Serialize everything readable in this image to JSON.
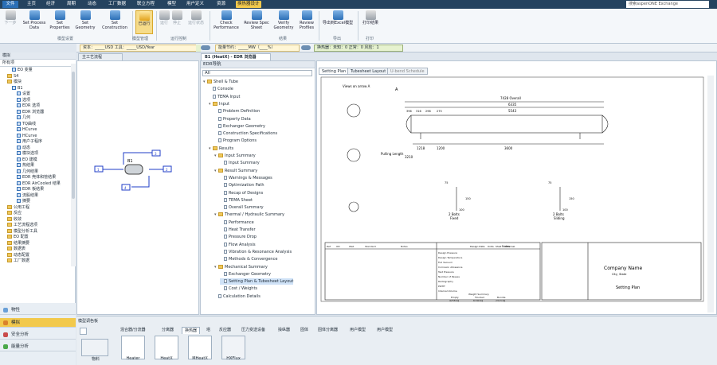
{
  "title_bar": {
    "menu": [
      "文件",
      "主页",
      "经济",
      "周期",
      "动态",
      "工厂数据",
      "联立方程",
      "模型",
      "用户定义",
      "资源",
      "换热器设计"
    ],
    "search_placeholder": "搜索aspenONE Exchange"
  },
  "ribbon": {
    "buttons": [
      {
        "label": "下一步",
        "state": "disabled"
      },
      {
        "label": "Set Process Data"
      },
      {
        "label": "Set Properties"
      },
      {
        "label": "Set Geometry"
      },
      {
        "label": "Set Construction"
      },
      {
        "label": "已运行",
        "state": "active"
      },
      {
        "label": "运行",
        "state": "disabled"
      },
      {
        "label": "停止",
        "state": "disabled"
      },
      {
        "label": "运行状态",
        "state": "disabled"
      },
      {
        "label": "Check Performance"
      },
      {
        "label": "Review Spec Sheet"
      },
      {
        "label": "Verify Geometry"
      },
      {
        "label": "Review Profiles"
      },
      {
        "label": "导出到Excel模型"
      },
      {
        "label": "打印结果"
      }
    ],
    "groups": [
      "模型设置",
      "模型管理",
      "运行控制",
      "结果",
      "导出",
      "打印"
    ]
  },
  "status_strip": {
    "cost_text": "资本：_____USD  工具：_____USD/Year",
    "energy_text": "能量节约：_____MW（____%）",
    "exchanger_text": "换热器：未知：0  正常：0  风险：1"
  },
  "left_panel": {
    "header": "模拟",
    "filter_value": "所有项",
    "tree": [
      "EO 变量",
      "S4",
      "模块",
      "B1",
      "设置",
      "选项",
      "EDR 选项",
      "EDR 浏览器",
      "几何",
      "TQ曲线",
      "HCurve",
      "HCurve",
      "用户子程序",
      "动态",
      "模块选项",
      "EO 建模",
      "热结果",
      "几何结果",
      "EDR 壳体和管结果",
      "EDR AirCooled 结果",
      "EDR 板结果",
      "流股结果",
      "摘要",
      "公用工程",
      "反应",
      "收敛",
      "工艺流程选项",
      "模型分析工具",
      "EO 配置",
      "结果摘要",
      "数据表",
      "动态配置",
      "工厂数据"
    ]
  },
  "nav_buttons": [
    "物性",
    "模拟",
    "安全分析",
    "能量分析"
  ],
  "doc_tabs": [
    "主工艺流程",
    "B1 (HeatX) - EDR 浏览器"
  ],
  "flowsheet": {
    "block_label": "B1",
    "streams": [
      "1",
      "2",
      "3",
      "4"
    ]
  },
  "edr_nav": {
    "header": "EDR导航",
    "filter_value": "All",
    "items": [
      "Shell & Tube",
      "Console",
      "TEMA Input",
      "Input",
      "Problem Definition",
      "Property Data",
      "Exchanger Geometry",
      "Construction Specifications",
      "Program Options",
      "Results",
      "Input Summary",
      "Input Summary",
      "Result Summary",
      "Warnings & Messages",
      "Optimization Path",
      "Recap of Designs",
      "TEMA Sheet",
      "Overall Summary",
      "Thermal / Hydraulic Summary",
      "Performance",
      "Heat Transfer",
      "Pressure Drop",
      "Flow Analysis",
      "Vibration & Resonance Analysis",
      "Methods & Convergence",
      "Mechanical Summary",
      "Exchanger Geometry",
      "Setting Plan & Tubesheet Layout",
      "Cost / Weights",
      "Calculation Details"
    ],
    "selected": "Setting Plan & Tubesheet Layout"
  },
  "drawing_tabs": [
    "Setting Plan",
    "Tubesheet Layout",
    "U-bend Schedule"
  ],
  "drawing": {
    "view_label": "Views on arrow A",
    "arrow_label": "A",
    "dims_top": [
      "7428  Overall",
      "6335",
      "5543",
      "396",
      "316",
      "296",
      "275"
    ],
    "dims_bottom": [
      "1218",
      "1200",
      "3600",
      "3210"
    ],
    "pulling_length": "Pulling Length",
    "support_labels": [
      "2  Bolts",
      "Fixed",
      "2  Bolts",
      "Sliding"
    ],
    "support_dims": [
      "75",
      "150",
      "100",
      "75",
      "150",
      "100"
    ],
    "company_name": "Company Name",
    "company_sub": "City, State",
    "sheet_title": "Setting Plan",
    "notes_label": "Notes",
    "design_table_header": [
      "Design Data",
      "Units",
      "Shell",
      "Channel"
    ],
    "design_rows": [
      "Design Pressure",
      "Design Temperature",
      "Full Vacuum",
      "Corrosion Allowance",
      "Test Pressure",
      "Number of Passes",
      "Radiography",
      "PWHT",
      "Internal Volume"
    ],
    "nozzle_header": [
      "Ref",
      "OD",
      "Wall",
      "Standard",
      "Notes"
    ],
    "weight_labels": [
      "Weight Summary",
      "Empty",
      "Flooded",
      "Bundle",
      "4258 kg",
      "6749 kg",
      "2313 kg"
    ]
  },
  "palette": {
    "header": "模型调色板",
    "tabs": [
      "混合器/分流器",
      "分离器",
      "换热器",
      "塔",
      "反应器",
      "压力变送设备",
      "操纵器",
      "固体",
      "固体分离器",
      "用户模型",
      "用户模型"
    ],
    "active_tab": "换热器",
    "blocks": [
      "物料",
      "Heater",
      "HeatX",
      "MHeatX",
      "HXFlux"
    ]
  },
  "colors": {
    "title_bar": "#25435f",
    "accent": "#f2c94c",
    "selected": "#cfe2f7"
  }
}
